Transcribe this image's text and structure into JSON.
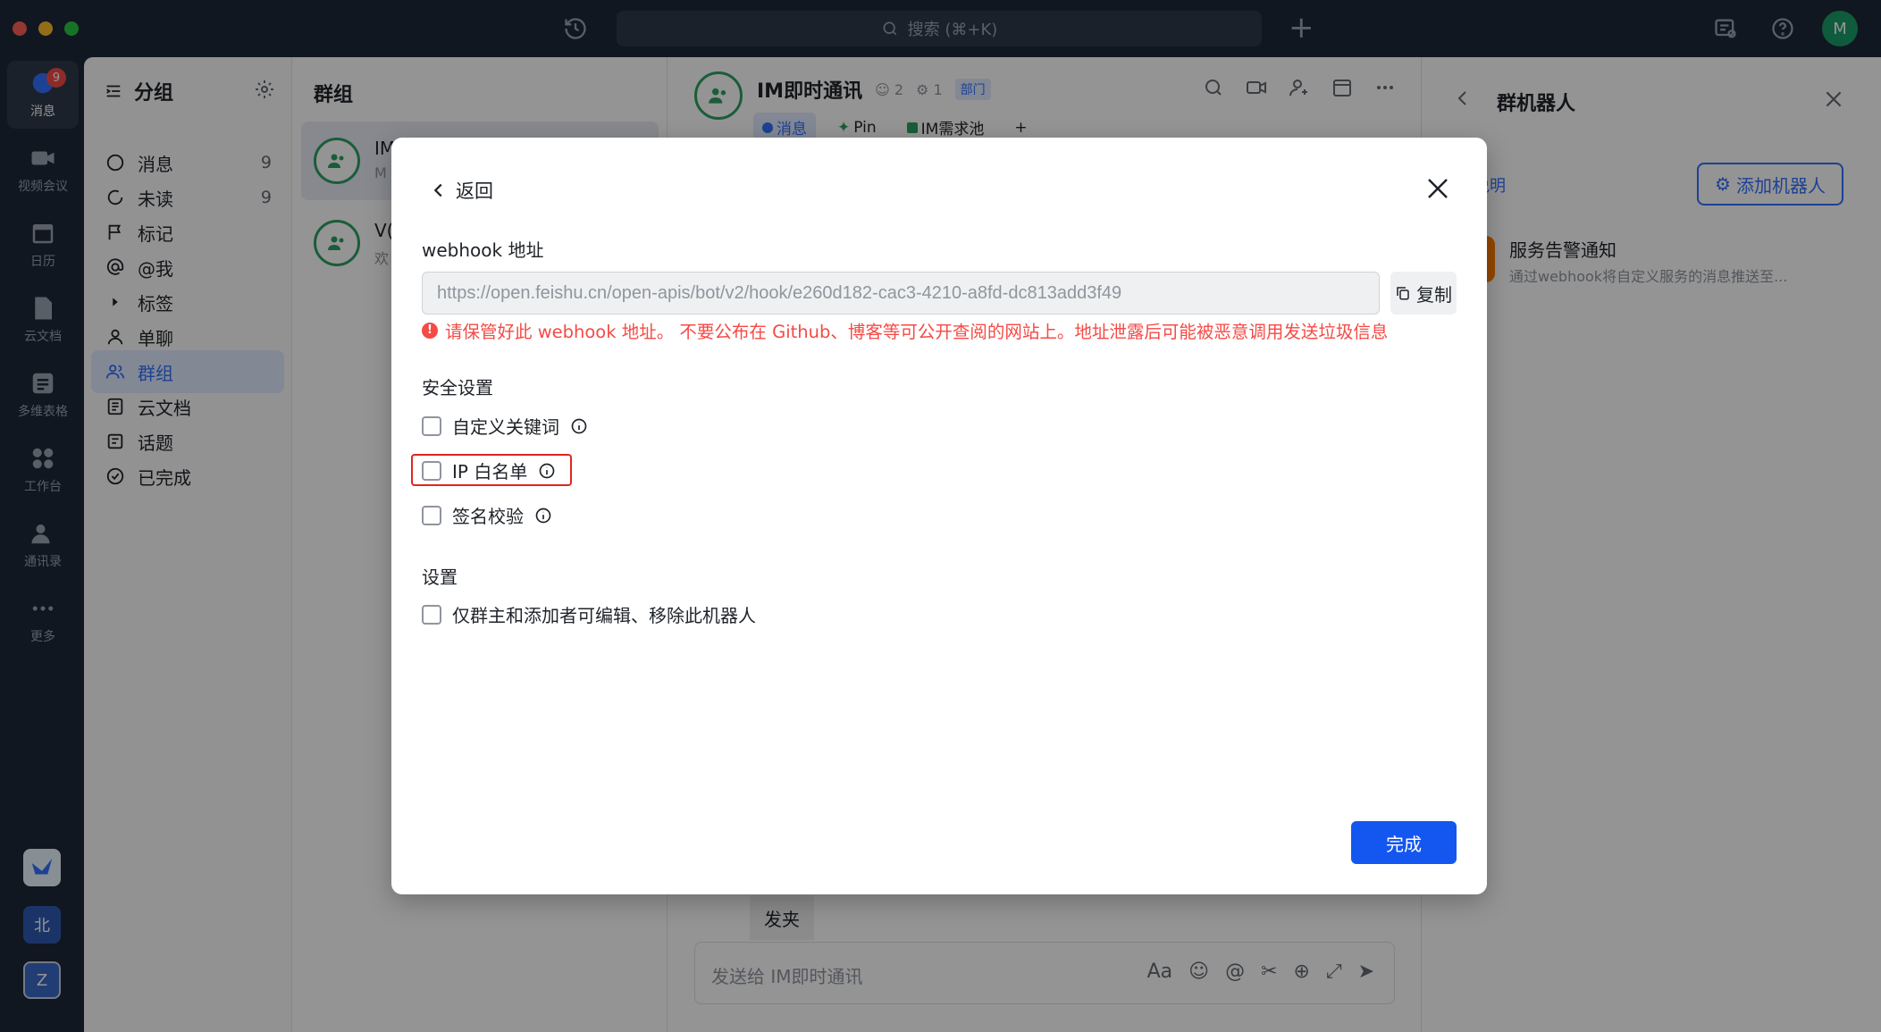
{
  "titlebar": {
    "search_placeholder": "搜索 (⌘+K)",
    "avatar_letter": "M"
  },
  "rail": {
    "items": [
      {
        "label": "消息",
        "badge": "9"
      },
      {
        "label": "视频会议"
      },
      {
        "label": "日历"
      },
      {
        "label": "云文档"
      },
      {
        "label": "多维表格"
      },
      {
        "label": "工作台"
      },
      {
        "label": "通讯录"
      },
      {
        "label": "更多"
      }
    ],
    "tenant_letters": [
      "北",
      "Z"
    ]
  },
  "sidebar": {
    "title": "分组",
    "items": [
      {
        "label": "消息",
        "count": "9"
      },
      {
        "label": "未读",
        "count": "9"
      },
      {
        "label": "标记"
      },
      {
        "label": "@我"
      },
      {
        "label": "标签"
      },
      {
        "label": "单聊"
      },
      {
        "label": "群组"
      },
      {
        "label": "云文档"
      },
      {
        "label": "话题"
      },
      {
        "label": "已完成"
      }
    ]
  },
  "grouplist": {
    "title": "群组",
    "rows": [
      {
        "name": "IM",
        "sub": "M"
      },
      {
        "name": "V(",
        "sub": "欢"
      }
    ]
  },
  "chat": {
    "title": "IM即时通讯",
    "member_count": "2",
    "bot_count": "1",
    "dept_tag": "部门",
    "tabs": [
      "消息",
      "Pin",
      "IM需求池"
    ],
    "folder_chip": "发夹",
    "composer_placeholder": "发送给 IM即时通讯"
  },
  "robotpanel": {
    "title": "群机器人",
    "usage_link": "用说明",
    "add_button": "添加机器人",
    "robot_name": "服务告警通知",
    "robot_desc": "通过webhook将自定义服务的消息推送至..."
  },
  "modal": {
    "back_label": "返回",
    "webhook_label": "webhook 地址",
    "webhook_url": "https://open.feishu.cn/open-apis/bot/v2/hook/e260d182-cac3-4210-a8fd-dc813add3f49",
    "copy_label": "复制",
    "warning": "请保管好此 webhook 地址。 不要公布在 Github、博客等可公开查阅的网站上。地址泄露后可能被恶意调用发送垃圾信息",
    "security_title": "安全设置",
    "security_options": [
      {
        "label": "自定义关键词",
        "checked": false
      },
      {
        "label": "IP 白名单",
        "checked": false
      },
      {
        "label": "签名校验",
        "checked": false
      }
    ],
    "settings_title": "设置",
    "settings_option": "仅群主和添加者可编辑、移除此机器人",
    "done_label": "完成"
  },
  "colors": {
    "accent": "#1456f0",
    "warning": "#f54a45",
    "highlight_border": "#e0261e",
    "rail_bg": "#1c2838"
  }
}
